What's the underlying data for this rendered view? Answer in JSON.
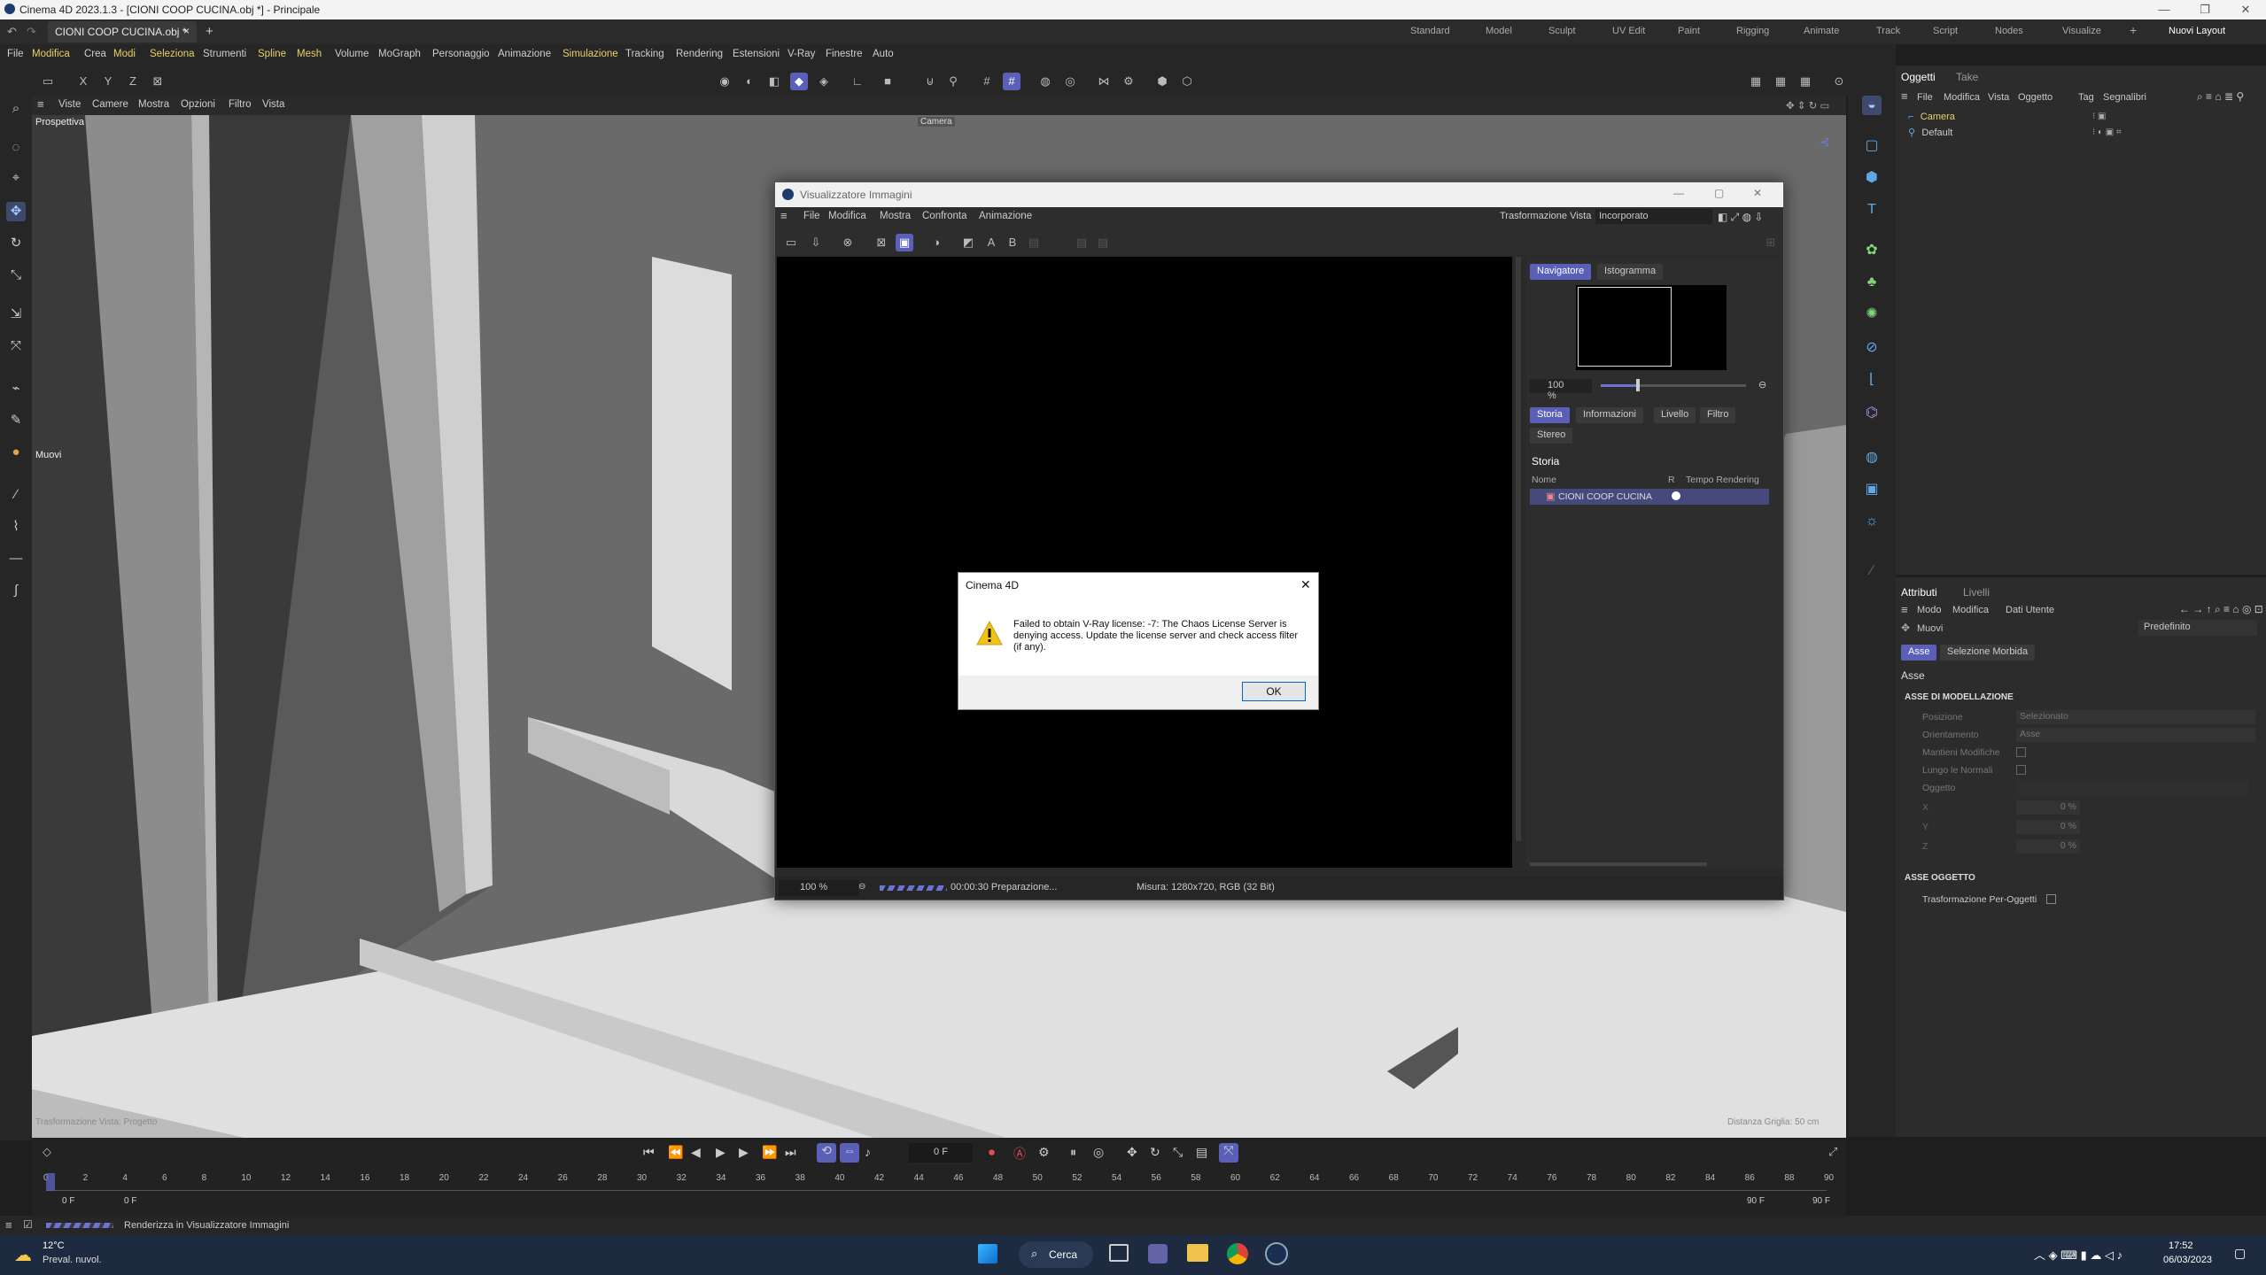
{
  "app": {
    "title": "Cinema 4D 2023.1.3 - [CIONI COOP CUCINA.obj *] - Principale"
  },
  "tabs": {
    "doc": "CIONI COOP CUCINA.obj *",
    "close": "×",
    "add": "+"
  },
  "layouts": [
    "Standard",
    "Model",
    "Sculpt",
    "UV Edit",
    "Paint",
    "Rigging",
    "Animate",
    "Track",
    "Script",
    "Nodes",
    "Visualize"
  ],
  "new_layout": "Nuovi Layout",
  "menu": [
    "File",
    "Modifica",
    "Crea",
    "Modi",
    "Seleziona",
    "Strumenti",
    "Spline",
    "Mesh",
    "Volume",
    "MoGraph",
    "Personaggio",
    "Animazione",
    "Simulazione",
    "Tracking",
    "Rendering",
    "Estensioni",
    "V-Ray",
    "Finestre",
    "Auto"
  ],
  "axes": {
    "x": "X",
    "y": "Y",
    "z": "Z"
  },
  "viewport": {
    "menu": [
      "Viste",
      "Camere",
      "Mostra",
      "Opzioni",
      "Filtro",
      "Vista"
    ],
    "label": "Prospettiva",
    "camera": "Camera",
    "tool_label": "Muovi",
    "bottom_left": "Trasformazione Vista: Progetto",
    "bottom_right": "Distanza Griglia: 50 cm"
  },
  "objects_panel": {
    "tabs": [
      "Oggetti",
      "Take"
    ],
    "menu": [
      "File",
      "Modifica",
      "Vista",
      "Oggetto",
      "Tag",
      "Segnalibri"
    ],
    "items": [
      "Camera",
      "Default"
    ]
  },
  "attr_panel": {
    "tabs": [
      "Attributi",
      "Livelli"
    ],
    "menu": [
      "Modo",
      "Modifica",
      "Dati Utente"
    ],
    "tool": "Muovi",
    "preset": "Predefinito",
    "subtabs": [
      "Asse",
      "Selezione Morbida"
    ],
    "section_title": "Asse",
    "group1": "ASSE DI MODELLAZIONE",
    "rows": [
      {
        "label": "Posizione",
        "value": "Selezionato"
      },
      {
        "label": "Orientamento",
        "value": "Asse"
      },
      {
        "label": "Mantieni Modifiche",
        "value": ""
      },
      {
        "label": "Lungo le Normali",
        "value": ""
      },
      {
        "label": "Oggetto",
        "value": ""
      }
    ],
    "xyz": [
      {
        "label": "X",
        "value": "0 %"
      },
      {
        "label": "Y",
        "value": "0 %"
      },
      {
        "label": "Z",
        "value": "0 %"
      }
    ],
    "group2": "ASSE OGGETTO",
    "per_object": "Trasformazione Per-Oggetti"
  },
  "picture_viewer": {
    "title": "Visualizzatore Immagini",
    "menu": [
      "File",
      "Modifica",
      "Mostra",
      "Confronta",
      "Animazione"
    ],
    "transform_label": "Trasformazione Vista",
    "transform_value": "Incorporato",
    "side_tabs": [
      "Navigatore",
      "Istogramma"
    ],
    "zoom": "100 %",
    "info_tabs": [
      "Storia",
      "Informazioni",
      "Livello",
      "Filtro",
      "Stereo"
    ],
    "history_title": "Storia",
    "cols": [
      "Nome",
      "R",
      "Tempo Rendering"
    ],
    "history_item": "CIONI COOP CUCINA",
    "footer_zoom": "100 %",
    "footer_progress": "00:00:30 Preparazione...",
    "footer_size": "Misura: 1280x720, RGB (32 Bit)"
  },
  "dialog": {
    "title": "Cinema 4D",
    "message": "Failed to obtain V-Ray license: -7: The Chaos License Server is denying access. Update the license server and check access filter (if any).",
    "ok": "OK"
  },
  "timeline": {
    "frame": "0 F",
    "ticks": [
      "0",
      "2",
      "4",
      "6",
      "8",
      "10",
      "12",
      "14",
      "16",
      "18",
      "20",
      "22",
      "24",
      "26",
      "28",
      "30",
      "32",
      "34",
      "36",
      "38",
      "40",
      "42",
      "44",
      "46",
      "48",
      "50",
      "52",
      "54",
      "56",
      "58",
      "60",
      "62",
      "64",
      "66",
      "68",
      "70",
      "72",
      "74",
      "76",
      "78",
      "80",
      "82",
      "84",
      "86",
      "88",
      "90"
    ],
    "start": "0 F",
    "start2": "0 F",
    "end": "90 F",
    "end2": "90 F"
  },
  "status": {
    "text": "Renderizza in Visualizzatore Immagini"
  },
  "taskbar": {
    "weather_temp": "12°C",
    "weather_desc": "Preval. nuvol.",
    "search": "Cerca",
    "time": "17:52",
    "date": "06/03/2023"
  }
}
